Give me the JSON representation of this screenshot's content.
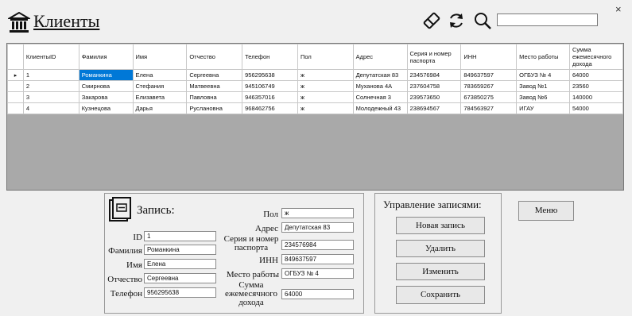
{
  "header": {
    "title": "Клиенты",
    "search_value": "",
    "close_label": "×"
  },
  "icons": {
    "title": "bank-building-icon",
    "clear": "eraser-icon",
    "refresh": "refresh-icon",
    "search": "search-icon",
    "record": "card-icon"
  },
  "table": {
    "columns": [
      "КлиентыID",
      "Фамилия",
      "Имя",
      "Отчество",
      "Телефон",
      "Пол",
      "Адрес",
      "Серия и номер паспорта",
      "ИНН",
      "Место работы",
      "Сумма ежемесячного дохода"
    ],
    "current_row_marker": "▸",
    "rows": [
      [
        "1",
        "Романкина",
        "Елена",
        "Сергеевна",
        "956295638",
        "ж",
        "Депутатская 83",
        "234576984",
        "849637597",
        "ОГБУЗ № 4",
        "64000"
      ],
      [
        "2",
        "Смирнова",
        "Стефания",
        "Матвеевна",
        "945106749",
        "ж",
        "Муханова 4А",
        "237604758",
        "783659267",
        "Завод №1",
        "23560"
      ],
      [
        "3",
        "Закарова",
        "Елизавета",
        "Павловна",
        "946357016",
        "ж",
        "Солнечная 3",
        "239573650",
        "673850275",
        "Завод №6",
        "140000"
      ],
      [
        "4",
        "Кузнецова",
        "Дарья",
        "Руслановна",
        "968462756",
        "ж",
        "Молодежный 43",
        "238694567",
        "784563927",
        "ИГАУ",
        "54000"
      ]
    ]
  },
  "record": {
    "title": "Запись:",
    "labels": {
      "id": "ID",
      "surname": "Фамилия",
      "name": "Имя",
      "patronymic": "Отчество",
      "phone": "Телефон",
      "gender": "Пол",
      "address": "Адрес",
      "passport_line1": "Серия и номер",
      "passport_line2": "паспорта",
      "inn": "ИНН",
      "workplace": "Место работы",
      "income_line1": "Сумма",
      "income_line2": "ежемесячного",
      "income_line3": "дохода"
    },
    "values": {
      "id": "1",
      "surname": "Романкина",
      "name": "Елена",
      "patronymic": "Сергеевна",
      "phone": "956295638",
      "gender": "ж",
      "address": "Депутатская 83",
      "passport": "234576984",
      "inn": "849637597",
      "workplace": "ОГБУЗ № 4",
      "income": "64000"
    }
  },
  "management": {
    "title": "Управление записями:",
    "buttons": [
      "Новая запись",
      "Удалить",
      "Изменить",
      "Сохранить"
    ]
  },
  "menu_button": "Меню",
  "colors": {
    "selection": "#0078d7",
    "grid_background": "#a9a9a9"
  }
}
